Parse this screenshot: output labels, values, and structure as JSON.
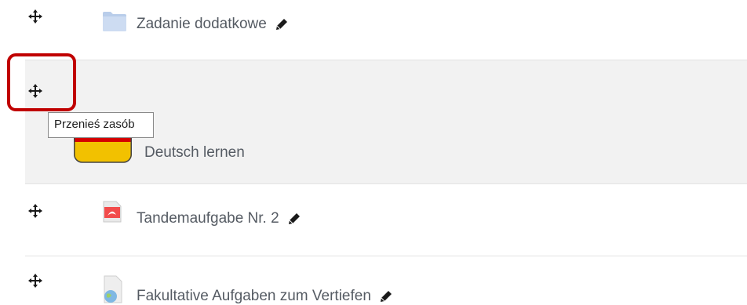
{
  "activities": [
    {
      "title": "Zadanie dodatkowe",
      "type": "folder-icon",
      "editable": true
    },
    {
      "title": "Deutsch lernen",
      "type": "german-flag-icon",
      "editable": false,
      "highlighted": true
    },
    {
      "title": "Tandemaufgabe Nr. 2",
      "type": "pdf-icon",
      "editable": true
    },
    {
      "title": "Fakultative Aufgaben zum Vertiefen",
      "type": "url-icon",
      "editable": true
    }
  ],
  "tooltip": {
    "text": "Przenieś zasób"
  },
  "colors": {
    "highlight_row": "#f2f2f2",
    "annotation": "#c00000",
    "flag_black": "#111111",
    "flag_red": "#d40000",
    "flag_gold": "#f2c100"
  }
}
